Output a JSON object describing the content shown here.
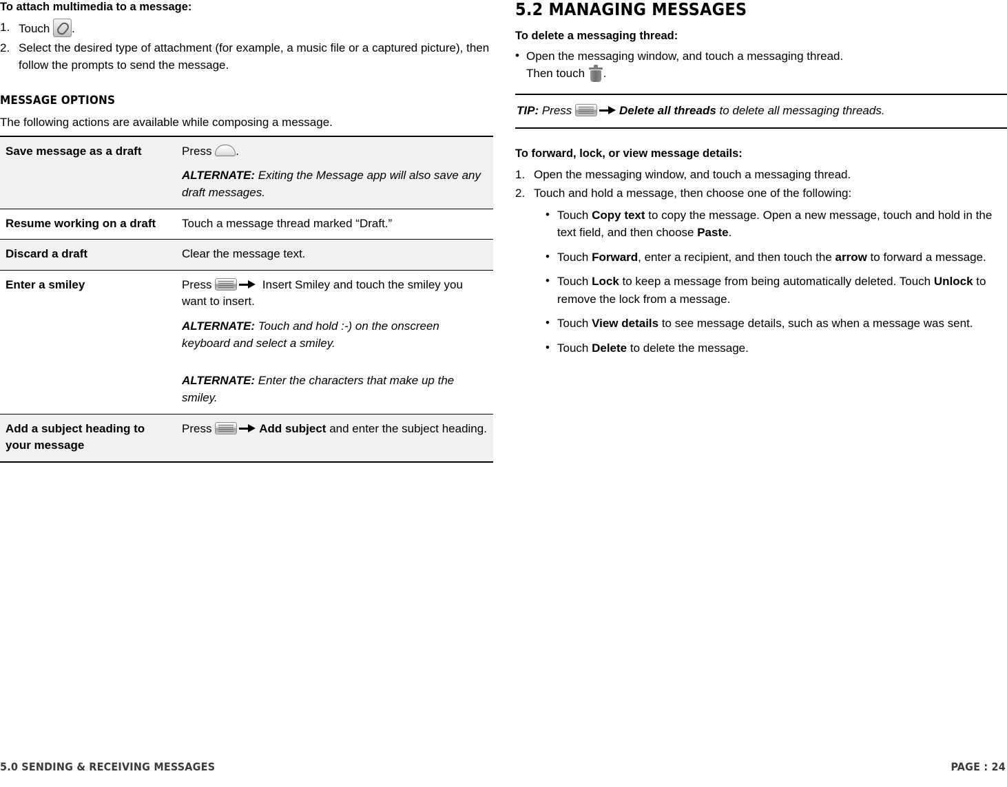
{
  "left": {
    "attach_heading": "To attach multimedia to a message:",
    "attach_steps": [
      {
        "num": "1.",
        "pre": "Touch ",
        "icon": "attachment-icon",
        "post": "."
      },
      {
        "num": "2.",
        "text": "Select the desired type of attachment (for example, a music file or a captured picture), then follow the prompts to send the message."
      }
    ],
    "options_heading": "MESSAGE OPTIONS",
    "options_intro": "The following actions are available while composing a message.",
    "table": {
      "rows": [
        {
          "label": "Save message as a draft",
          "desc_pre": "Press ",
          "desc_icon": "back-key-icon",
          "desc_post": ".",
          "alt_label": "ALTERNATE:",
          "alt_text": " Exiting the Message app will also save any draft messages.",
          "shaded": true
        },
        {
          "label": "Resume working on a draft",
          "desc_plain": "Touch a message thread marked “Draft.”",
          "shaded": false
        },
        {
          "label": "Discard a draft",
          "desc_plain": "Clear the message text.",
          "shaded": true
        },
        {
          "label": "Enter a smiley",
          "desc_pre": "Press ",
          "desc_icon": "menu-key-icon",
          "desc_arrow": "arrow-icon",
          "desc_post": " Insert Smiley and touch the smiley you want to insert.",
          "alt_label": "ALTERNATE:",
          "alt_text": " Touch and hold :-) on the onscreen keyboard and select a smiley.",
          "alt2_label": "ALTERNATE:",
          "alt2_text": " Enter the characters that make up the smiley.",
          "shaded": false
        },
        {
          "label": "Add a subject heading to your message",
          "desc_pre": "Press ",
          "desc_icon": "menu-key-icon",
          "desc_arrow": "arrow-icon",
          "desc_bold": "Add subject",
          "desc_post": " and enter the subject heading.",
          "shaded": true
        }
      ]
    }
  },
  "right": {
    "section_title": "5.2 MANAGING MESSAGES",
    "delete_heading": "To delete a messaging thread:",
    "delete_bullet_line1": "Open the messaging window, and touch a messaging thread.",
    "delete_bullet_line2_pre": "Then touch ",
    "delete_bullet_icon": "trash-icon",
    "delete_bullet_line2_post": ".",
    "tip": {
      "label": "TIP:",
      "pre": " Press ",
      "icon": "menu-key-icon",
      "arrow": "arrow-icon",
      "bold": "Delete all threads",
      "post": " to delete all messaging threads."
    },
    "forward_heading": "To forward, lock, or view message details:",
    "forward_steps": [
      {
        "num": "1.",
        "text": "Open the messaging window, and touch a messaging thread."
      },
      {
        "num": "2.",
        "text": "Touch and hold a message, then choose one of the following:"
      }
    ],
    "sub_bullets": [
      {
        "pre": "Touch ",
        "bold": "Copy text",
        "mid": " to copy the message. Open a new message, touch and hold in the text field, and then choose ",
        "bold2": "Paste",
        "post": "."
      },
      {
        "pre": "Touch ",
        "bold": "Forward",
        "mid": ", enter a recipient, and then touch the ",
        "bold2": "arrow",
        "post": " to forward a message."
      },
      {
        "pre": "Touch ",
        "bold": "Lock",
        "mid": " to keep a message from being automatically deleted. Touch ",
        "bold2": "Unlock",
        "post": " to remove the lock from a message."
      },
      {
        "pre": "Touch ",
        "bold": "View details",
        "mid": " to see message details, such as when a message was sent.",
        "bold2": "",
        "post": ""
      },
      {
        "pre": "Touch ",
        "bold": "Delete",
        "mid": " to delete the message.",
        "bold2": "",
        "post": ""
      }
    ]
  },
  "footer": {
    "left": "5.0 SENDING & RECEIVING MESSAGES",
    "right": "PAGE : 24"
  }
}
